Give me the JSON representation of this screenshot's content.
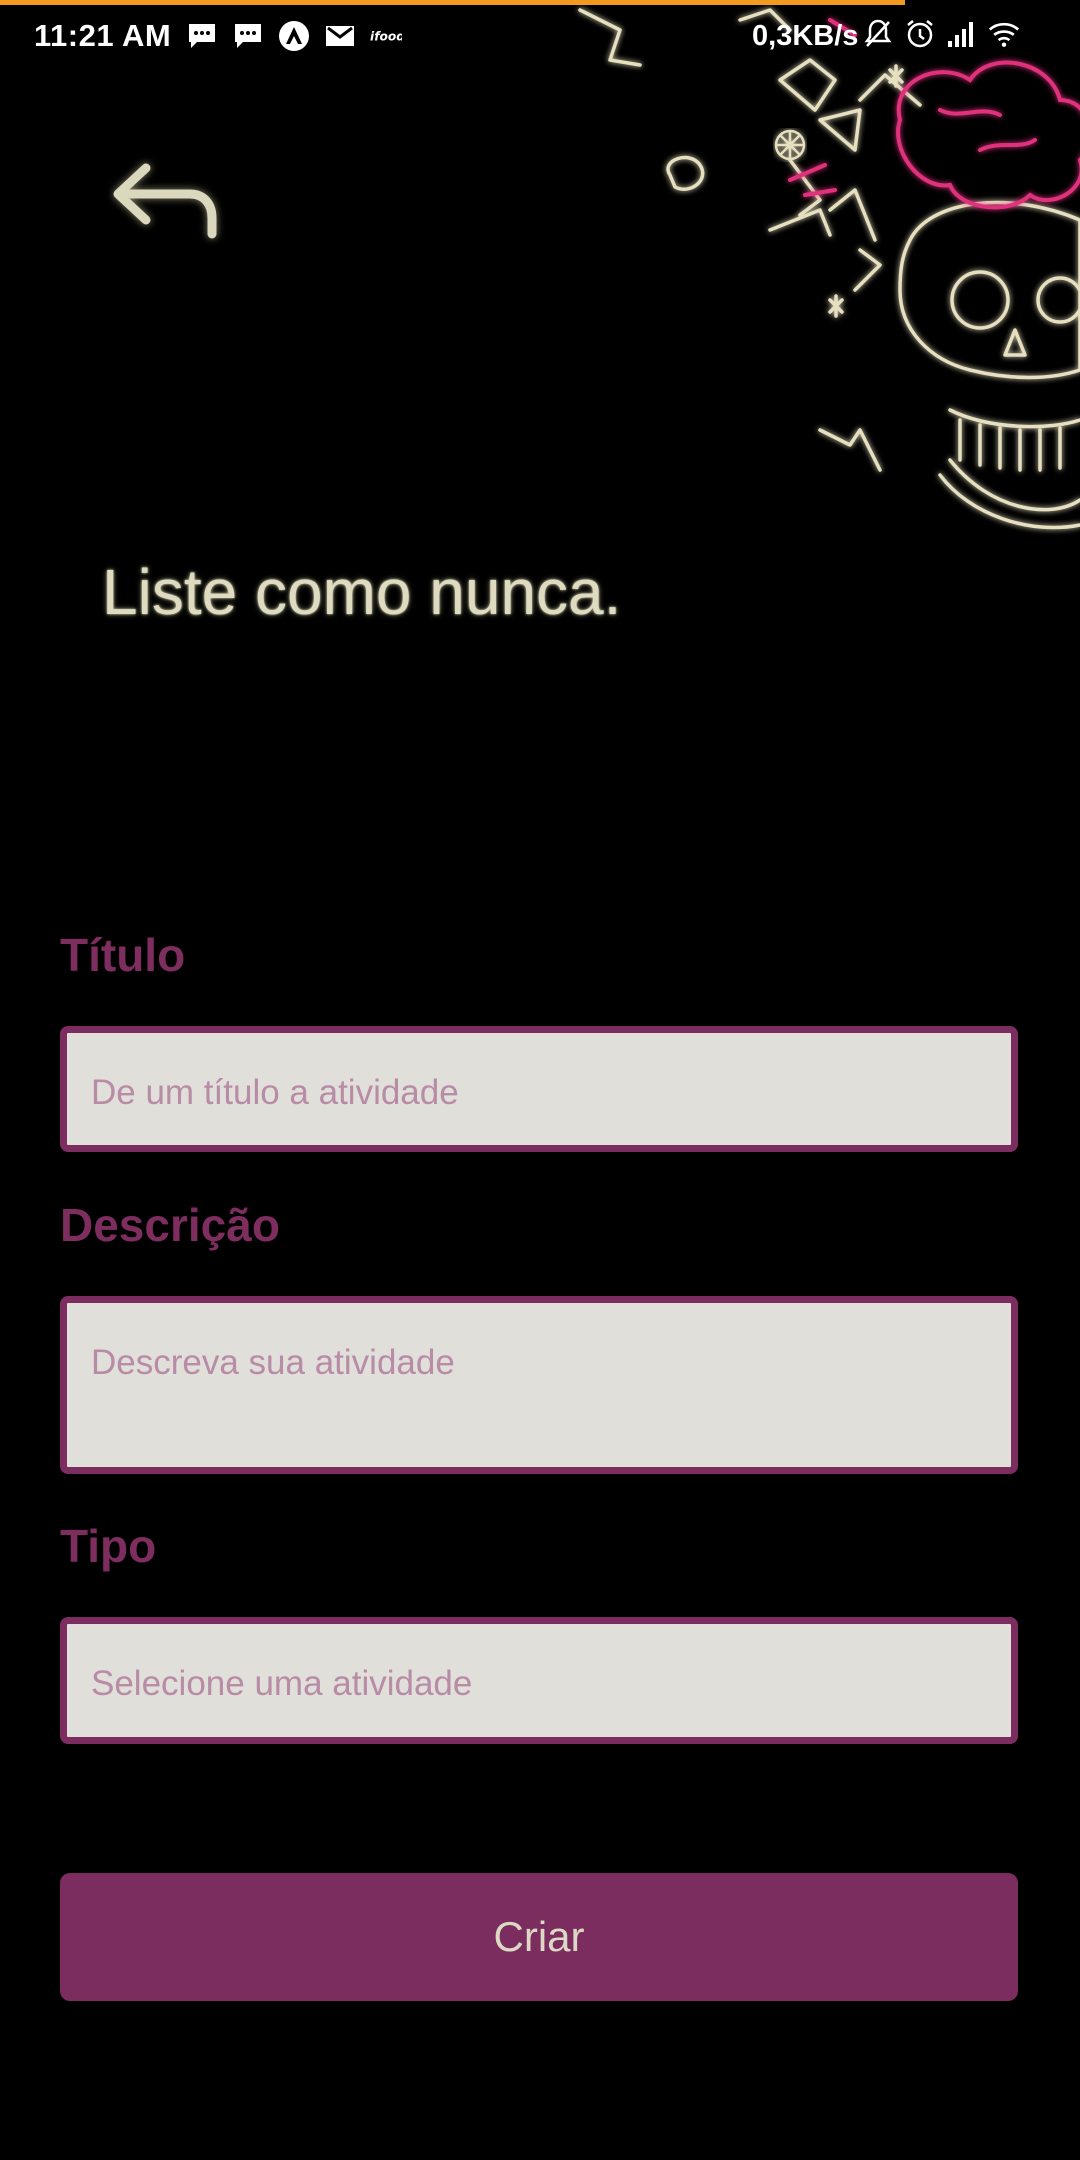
{
  "status_bar": {
    "time": "11:21 AM",
    "speed": "0,3KB/s",
    "left_icons": [
      "message-icon",
      "message-icon",
      "vpn-icon",
      "gmail-icon",
      "ifood-icon"
    ],
    "right_icons": [
      "bell-off-icon",
      "alarm-icon",
      "signal-icon",
      "wifi-icon"
    ]
  },
  "header": {
    "back_icon": "reply-arrow-icon",
    "headline": "Liste como nunca."
  },
  "form": {
    "title_label": "Título",
    "title_placeholder": "De um título a atividade",
    "description_label": "Descrição",
    "description_placeholder": "Descreva sua atividade",
    "type_label": "Tipo",
    "type_placeholder": "Selecione uma atividade",
    "submit_label": "Criar"
  },
  "colors": {
    "background": "#000000",
    "accent": "#7b2d5f",
    "input_background": "#e1dfda",
    "placeholder": "#b88ba6",
    "headline": "#dedbc0",
    "top_line": "#f29a1f"
  }
}
